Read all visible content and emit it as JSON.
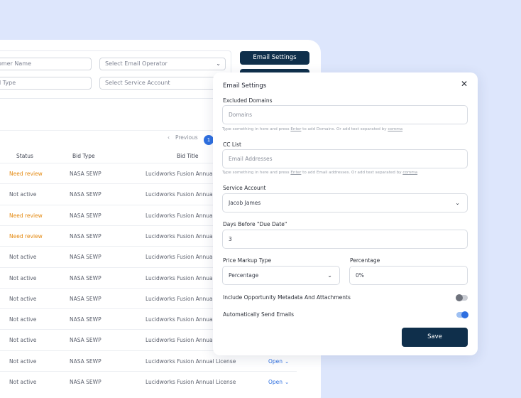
{
  "background": {
    "filters": {
      "customer_name_placeholder": "Customer Name",
      "email_operator_placeholder": "Select Email Operator",
      "email_type_placeholder": "Email Type",
      "service_account_placeholder": "Select Service Account"
    },
    "buttons": {
      "email_settings": "Email Settings"
    },
    "pager": {
      "previous": "Previous",
      "current_page": "1"
    },
    "table": {
      "columns": [
        "Status",
        "Bid Type",
        "Bid Title"
      ],
      "rows": [
        {
          "status": "Need review",
          "bid_type": "NASA SEWP",
          "bid_title": "Lucidworks Fusion Annual License",
          "action": ""
        },
        {
          "status": "Not active",
          "bid_type": "NASA SEWP",
          "bid_title": "Lucidworks Fusion Annual License",
          "action": ""
        },
        {
          "status": "Need review",
          "bid_type": "NASA SEWP",
          "bid_title": "Lucidworks Fusion Annual License",
          "action": ""
        },
        {
          "status": "Need review",
          "bid_type": "NASA SEWP",
          "bid_title": "Lucidworks Fusion Annual License",
          "action": ""
        },
        {
          "status": "Not active",
          "bid_type": "NASA SEWP",
          "bid_title": "Lucidworks Fusion Annual License",
          "action": ""
        },
        {
          "status": "Not active",
          "bid_type": "NASA SEWP",
          "bid_title": "Lucidworks Fusion Annual License",
          "action": ""
        },
        {
          "status": "Not active",
          "bid_type": "NASA SEWP",
          "bid_title": "Lucidworks Fusion Annual License",
          "action": ""
        },
        {
          "status": "Not active",
          "bid_type": "NASA SEWP",
          "bid_title": "Lucidworks Fusion Annual License",
          "action": ""
        },
        {
          "status": "Not active",
          "bid_type": "NASA SEWP",
          "bid_title": "Lucidworks Fusion Annual License",
          "action": ""
        },
        {
          "status": "Not active",
          "bid_type": "NASA SEWP",
          "bid_title": "Lucidworks Fusion Annual License",
          "action": "Open"
        },
        {
          "status": "Not active",
          "bid_type": "NASA SEWP",
          "bid_title": "Lucidworks Fusion Annual License",
          "action": "Open"
        }
      ]
    }
  },
  "modal": {
    "title": "Email Settings",
    "excluded_domains": {
      "label": "Excluded Domains",
      "placeholder": "Domains",
      "help_pre": "Type something in here and press ",
      "help_enter": "Enter",
      "help_mid": " to add Domains. Or add text separated by ",
      "help_comma": "comma"
    },
    "cc_list": {
      "label": "CC List",
      "placeholder": "Email Addresses",
      "help_pre": "Type something in here and press ",
      "help_enter": "Enter",
      "help_mid": " to add Email addresses. Or add text separated by ",
      "help_comma": "comma"
    },
    "service_account": {
      "label": "Service Account",
      "value": "Jacob James"
    },
    "days_before": {
      "label": "Days Before \"Due Date\"",
      "value": "3"
    },
    "price_markup": {
      "label": "Price Markup Type",
      "value": "Percentage"
    },
    "percentage": {
      "label": "Percentage",
      "value": "0%"
    },
    "include_metadata": {
      "label": "Include Opportunity Metadata And Attachments",
      "on": false
    },
    "auto_send": {
      "label": "Automatically Send Emails",
      "on": true
    },
    "save_label": "Save"
  },
  "colors": {
    "page_bg": "#dde6fc",
    "primary_dark": "#0f2f4b",
    "accent_blue": "#2e6fe0",
    "warning_orange": "#e48a12"
  }
}
